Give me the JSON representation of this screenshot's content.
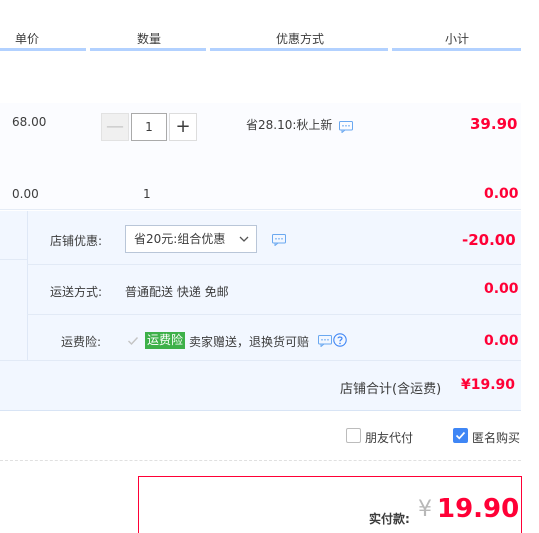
{
  "header": {
    "col_unit_price": "单价",
    "col_quantity": "数量",
    "col_discount": "优惠方式",
    "col_subtotal": "小计"
  },
  "item1": {
    "unit_price": "68.00",
    "quantity": "1",
    "minus_label": "—",
    "plus_label": "+",
    "discount_text": "省28.10:秋上新",
    "subtotal": "39.90"
  },
  "item2": {
    "unit_price": "0.00",
    "quantity": "1",
    "subtotal": "0.00"
  },
  "shop": {
    "discount_label": "店铺优惠:",
    "discount_selected": "省20元:组合优惠",
    "discount_amount": "-20.00",
    "shipping_label": "运送方式:",
    "shipping_value": "普通配送 快递 免邮",
    "shipping_amount": "0.00",
    "insurance_label": "运费险:",
    "insurance_tag": "运费险",
    "insurance_desc": "卖家赠送，退换货可赔",
    "insurance_amount": "0.00",
    "total_label": "店铺合计(含运费)",
    "total_value": "¥19.90"
  },
  "options": {
    "friend_pay_label": "朋友代付",
    "friend_pay_checked": false,
    "anonymous_label": "匿名购买",
    "anonymous_checked": true
  },
  "payment": {
    "label": "实付款:",
    "currency": "¥",
    "amount": "19.90"
  },
  "colors": {
    "accent_red": "#ff0036",
    "accent_blue": "#3f86f5",
    "tag_green": "#3db049"
  },
  "icons": [
    "message-icon",
    "help-icon",
    "chevron-down-icon",
    "check-icon"
  ]
}
